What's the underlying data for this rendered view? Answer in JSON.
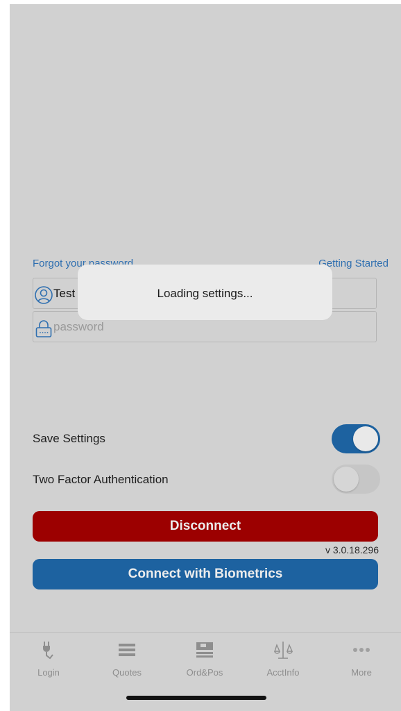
{
  "links": {
    "forgot_password": "Forgot your password",
    "getting_started": "Getting Started"
  },
  "form": {
    "username_value": "Test",
    "password_placeholder": "password"
  },
  "loading": {
    "message": "Loading settings..."
  },
  "settings": {
    "save_settings_label": "Save Settings",
    "save_settings_on": true,
    "two_factor_label": "Two Factor Authentication",
    "two_factor_on": false
  },
  "buttons": {
    "disconnect": "Disconnect",
    "connect_biometrics": "Connect with Biometrics"
  },
  "version": "v 3.0.18.296",
  "tabbar": {
    "items": [
      {
        "label": "Login",
        "icon": "plug-icon"
      },
      {
        "label": "Quotes",
        "icon": "list-icon"
      },
      {
        "label": "Ord&Pos",
        "icon": "document-icon"
      },
      {
        "label": "AcctInfo",
        "icon": "scale-icon"
      },
      {
        "label": "More",
        "icon": "more-dots-icon"
      }
    ]
  },
  "colors": {
    "background": "#d1d1d1",
    "accent_blue": "#1d62a0",
    "disconnect_red": "#9c0000",
    "link_blue": "#2f6fb0"
  }
}
